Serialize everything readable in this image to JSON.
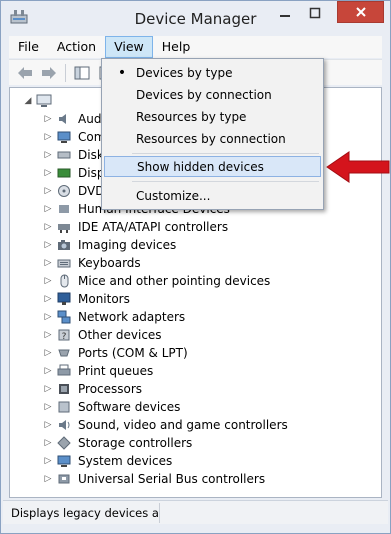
{
  "window": {
    "title": "Device Manager"
  },
  "menubar": {
    "file": "File",
    "action": "Action",
    "view": "View",
    "help": "Help"
  },
  "view_menu": {
    "items": [
      {
        "label": "Devices by type",
        "checked": true
      },
      {
        "label": "Devices by connection",
        "checked": false
      },
      {
        "label": "Resources by type",
        "checked": false
      },
      {
        "label": "Resources by connection",
        "checked": false
      },
      {
        "label": "Show hidden devices",
        "checked": false,
        "highlighted": true
      },
      {
        "label": "Customize...",
        "checked": false
      }
    ]
  },
  "tree": {
    "visible_partial": [
      "Aud",
      "Com",
      "Disk",
      "Disp",
      "DVD",
      "Human Interface Devices"
    ],
    "rows": [
      {
        "label": "IDE ATA/ATAPI controllers",
        "icon": "ide-controller-icon"
      },
      {
        "label": "Imaging devices",
        "icon": "camera-icon"
      },
      {
        "label": "Keyboards",
        "icon": "keyboard-icon"
      },
      {
        "label": "Mice and other pointing devices",
        "icon": "mouse-icon"
      },
      {
        "label": "Monitors",
        "icon": "monitor-icon"
      },
      {
        "label": "Network adapters",
        "icon": "network-icon"
      },
      {
        "label": "Other devices",
        "icon": "unknown-device-icon"
      },
      {
        "label": "Ports (COM & LPT)",
        "icon": "port-icon"
      },
      {
        "label": "Print queues",
        "icon": "printer-icon"
      },
      {
        "label": "Processors",
        "icon": "processor-icon"
      },
      {
        "label": "Software devices",
        "icon": "software-device-icon"
      },
      {
        "label": "Sound, video and game controllers",
        "icon": "speaker-icon"
      },
      {
        "label": "Storage controllers",
        "icon": "storage-icon"
      },
      {
        "label": "System devices",
        "icon": "system-device-icon"
      },
      {
        "label": "Universal Serial Bus controllers",
        "icon": "usb-icon"
      }
    ]
  },
  "statusbar": {
    "text": "Displays legacy devices anc"
  },
  "colors": {
    "accent": "#3399ff",
    "arrow": "#d4141c",
    "close": "#c7463a"
  }
}
